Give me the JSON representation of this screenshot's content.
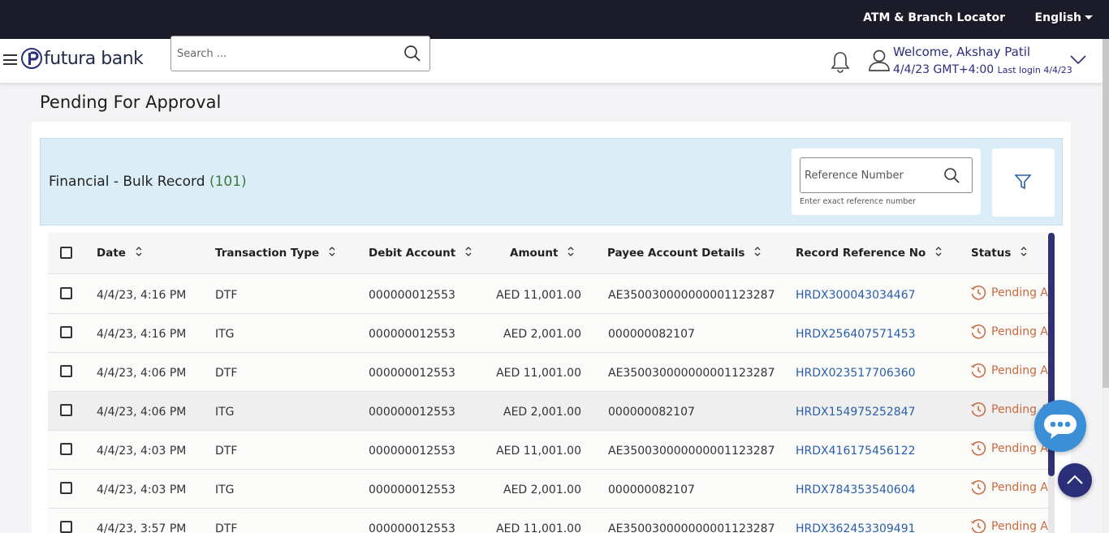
{
  "topbar": {
    "atm_label": "ATM & Branch Locator",
    "language": "English"
  },
  "header": {
    "brand": "futura bank",
    "search_placeholder": "Search ...",
    "welcome": "Welcome, Akshay Patil",
    "login_time": "4/4/23 GMT+4:00",
    "last_login": "Last login 4/4/23"
  },
  "page": {
    "title": "Pending For Approval"
  },
  "banner": {
    "title": "Financial - Bulk Record",
    "count": "(101)",
    "ref_placeholder": "Reference Number",
    "ref_hint": "Enter exact reference number"
  },
  "table": {
    "headers": [
      "Date",
      "Transaction Type",
      "Debit Account",
      "Amount",
      "Payee Account Details",
      "Record Reference No",
      "Status"
    ],
    "rows": [
      {
        "date": "4/4/23, 4:16 PM",
        "type": "DTF",
        "debit": "000000012553",
        "amount": "AED 11,001.00",
        "payee": "AE350030000000001123287",
        "ref": "HRDX300043034467",
        "status": "Pending Ap"
      },
      {
        "date": "4/4/23, 4:16 PM",
        "type": "ITG",
        "debit": "000000012553",
        "amount": "AED 2,001.00",
        "payee": "000000082107",
        "ref": "HRDX256407571453",
        "status": "Pending Ap"
      },
      {
        "date": "4/4/23, 4:06 PM",
        "type": "DTF",
        "debit": "000000012553",
        "amount": "AED 11,001.00",
        "payee": "AE350030000000001123287",
        "ref": "HRDX023517706360",
        "status": "Pending Ap"
      },
      {
        "date": "4/4/23, 4:06 PM",
        "type": "ITG",
        "debit": "000000012553",
        "amount": "AED 2,001.00",
        "payee": "000000082107",
        "ref": "HRDX154975252847",
        "status": "Pending Ap"
      },
      {
        "date": "4/4/23, 4:03 PM",
        "type": "DTF",
        "debit": "000000012553",
        "amount": "AED 11,001.00",
        "payee": "AE350030000000001123287",
        "ref": "HRDX416175456122",
        "status": "Pending Ap"
      },
      {
        "date": "4/4/23, 4:03 PM",
        "type": "ITG",
        "debit": "000000012553",
        "amount": "AED 2,001.00",
        "payee": "000000082107",
        "ref": "HRDX784353540604",
        "status": "Pending Ap"
      },
      {
        "date": "4/4/23, 3:57 PM",
        "type": "DTF",
        "debit": "000000012553",
        "amount": "AED 11,001.00",
        "payee": "AE350030000000001123287",
        "ref": "HRDX362453309491",
        "status": "Pending Ap"
      }
    ]
  },
  "colors": {
    "navy": "#2b2f7a",
    "link": "#2a5fa8",
    "pending": "#c8693f",
    "banner_bg": "#dbeef7"
  }
}
